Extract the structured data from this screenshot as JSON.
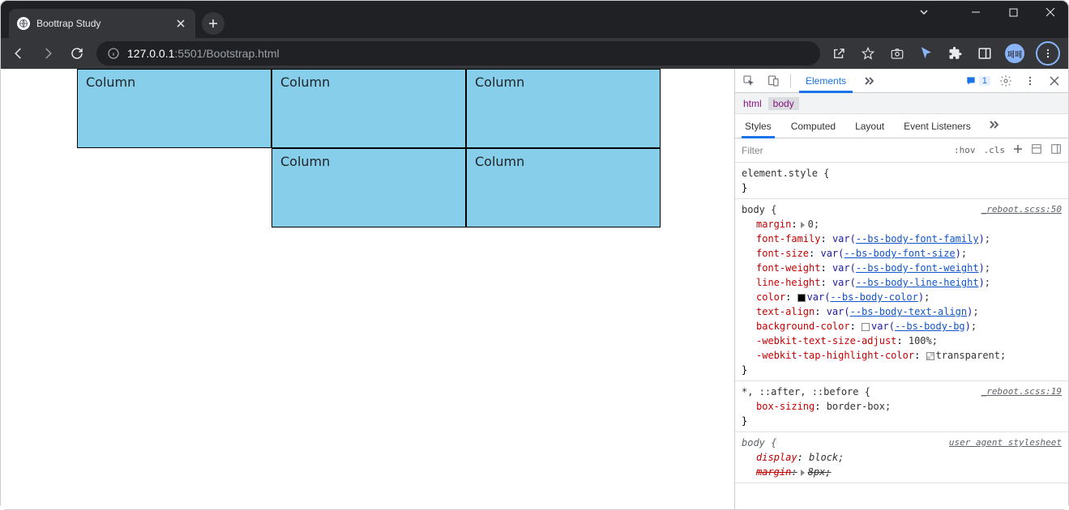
{
  "browser": {
    "tab_title": "Boottrap Study",
    "url_host": "127.0.0.1",
    "url_port": ":5501",
    "url_path": "/Bootstrap.html"
  },
  "page": {
    "columns": [
      "Column",
      "Column",
      "Column",
      "Column",
      "Column"
    ]
  },
  "devtools": {
    "main_tabs": {
      "elements": "Elements"
    },
    "messages_count": "1",
    "breadcrumb": {
      "html": "html",
      "body": "body"
    },
    "styles_tabs": {
      "styles": "Styles",
      "computed": "Computed",
      "layout": "Layout",
      "event_listeners": "Event Listeners"
    },
    "filter_placeholder": "Filter",
    "hov": ":hov",
    "cls": ".cls",
    "rules": {
      "element_style": "element.style {",
      "body_sel": "body {",
      "body_src": "_reboot.scss:50",
      "margin": "margin",
      "margin_val": "0;",
      "font_family": "font-family",
      "font_family_var": "--bs-body-font-family",
      "font_size": "font-size",
      "font_size_var": "--bs-body-font-size",
      "font_weight": "font-weight",
      "font_weight_var": "--bs-body-font-weight",
      "line_height": "line-height",
      "line_height_var": "--bs-body-line-height",
      "color": "color",
      "color_var": "--bs-body-color",
      "text_align": "text-align",
      "text_align_var": "--bs-body-text-align",
      "background_color": "background-color",
      "background_color_var": "--bs-body-bg",
      "wtsa": "-webkit-text-size-adjust",
      "wtsa_val": "100%;",
      "wthc": "-webkit-tap-highlight-color",
      "wthc_val": "transparent;",
      "star_sel": "*, ::after, ::before {",
      "star_src": "_reboot.scss:19",
      "box_sizing": "box-sizing",
      "box_sizing_val": "border-box;",
      "ua_body_sel": "body {",
      "ua_src": "user agent stylesheet",
      "display": "display",
      "display_val": "block;",
      "margin2": "margin",
      "margin2_val": "8px;"
    }
  }
}
